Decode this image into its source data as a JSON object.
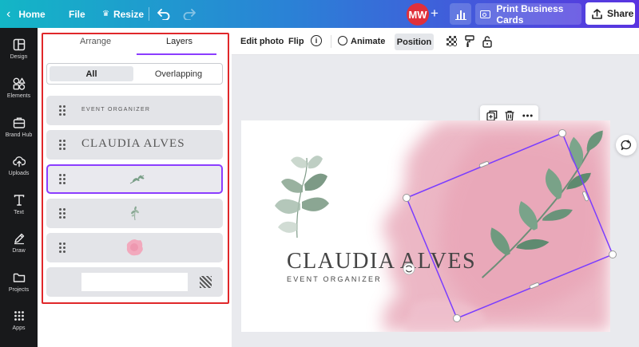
{
  "topbar": {
    "home": "Home",
    "file": "File",
    "resize": "Resize",
    "avatar_initials": "MW",
    "print_label": "Print Business Cards",
    "share_label": "Share",
    "gradient_start": "#13b6c6",
    "gradient_end": "#5a33e0"
  },
  "rail": {
    "items": [
      {
        "label": "Design",
        "icon": "layout-icon"
      },
      {
        "label": "Elements",
        "icon": "shapes-icon"
      },
      {
        "label": "Brand Hub",
        "icon": "brand-icon"
      },
      {
        "label": "Uploads",
        "icon": "cloud-upload-icon"
      },
      {
        "label": "Text",
        "icon": "text-icon"
      },
      {
        "label": "Draw",
        "icon": "pen-icon"
      },
      {
        "label": "Projects",
        "icon": "folder-icon"
      },
      {
        "label": "Apps",
        "icon": "grid-icon"
      }
    ]
  },
  "panel": {
    "tabs": [
      "Arrange",
      "Layers"
    ],
    "active_tab": "Layers",
    "filters": [
      "All",
      "Overlapping"
    ],
    "active_filter": "All",
    "layers": [
      {
        "type": "text",
        "text": "EVENT ORGANIZER"
      },
      {
        "type": "text",
        "text": "CLAUDIA ALVES"
      },
      {
        "type": "image",
        "icon": "leaf-branch-icon",
        "selected": true
      },
      {
        "type": "image",
        "icon": "leaf-sprig-icon"
      },
      {
        "type": "image",
        "icon": "pink-blot-icon"
      },
      {
        "type": "background",
        "icon": "lock-pattern-icon"
      }
    ],
    "accent": "#8b3dff",
    "outline_color": "#e0272a"
  },
  "context_toolbar": {
    "edit_photo": "Edit photo",
    "flip": "Flip",
    "info": "i",
    "animate": "Animate",
    "position": "Position"
  },
  "card": {
    "name": "CLAUDIA ALVES",
    "subtitle": "EVENT ORGANIZER",
    "wash_color": "#eab0bf"
  }
}
